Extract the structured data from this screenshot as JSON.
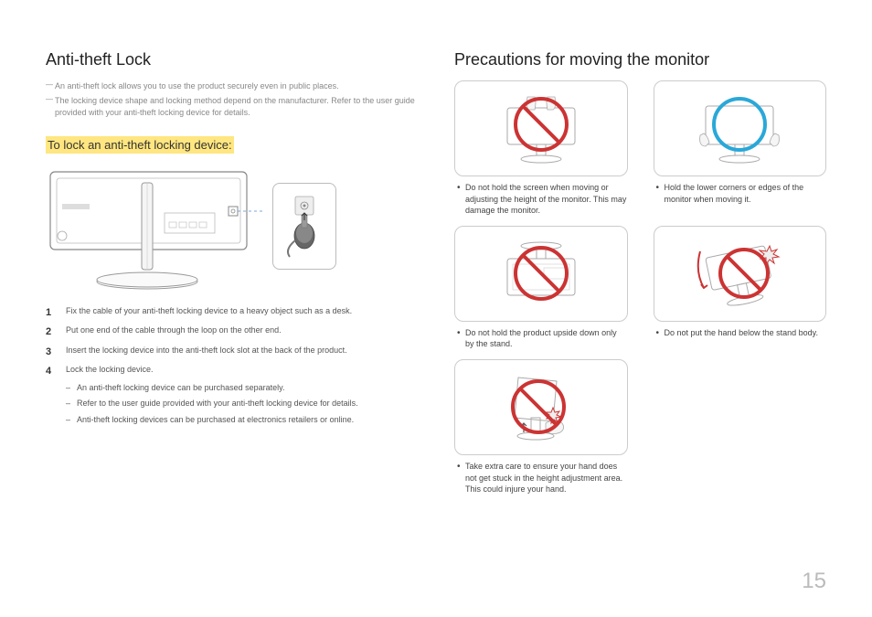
{
  "page_number": "15",
  "left": {
    "title": "Anti-theft Lock",
    "intro": [
      "An anti-theft lock allows you to use the product securely even in public places.",
      "The locking device shape and locking method depend on the manufacturer. Refer to the user guide provided with your anti-theft locking device for details."
    ],
    "subheading": "To lock an anti-theft locking device:",
    "steps": [
      "Fix the cable of your anti-theft locking device to a heavy object such as a desk.",
      "Put one end of the cable through the loop on the other end.",
      "Insert the locking device into the anti-theft lock slot at the back of the product.",
      "Lock the locking device."
    ],
    "substeps": [
      "An anti-theft locking device can be purchased separately.",
      "Refer to the user guide provided with your anti-theft locking device for details.",
      "Anti-theft locking devices can be purchased at electronics retailers or online."
    ]
  },
  "right": {
    "title": "Precautions for moving the monitor",
    "items": [
      {
        "caption": "Do not hold the screen when moving or adjusting the height of the monitor. This may damage the monitor.",
        "icon": "prohibit-screen"
      },
      {
        "caption": "Hold the lower corners or edges of the monitor when moving it.",
        "icon": "allow-corners"
      },
      {
        "caption": "Do not hold the product upside down only by the stand.",
        "icon": "prohibit-upside"
      },
      {
        "caption": "Do not put the hand below the stand body.",
        "icon": "prohibit-hand-stand"
      },
      {
        "caption": "Take extra care to ensure your hand does not get stuck in the height adjustment area. This could injure your hand.",
        "icon": "prohibit-pinch"
      }
    ]
  }
}
